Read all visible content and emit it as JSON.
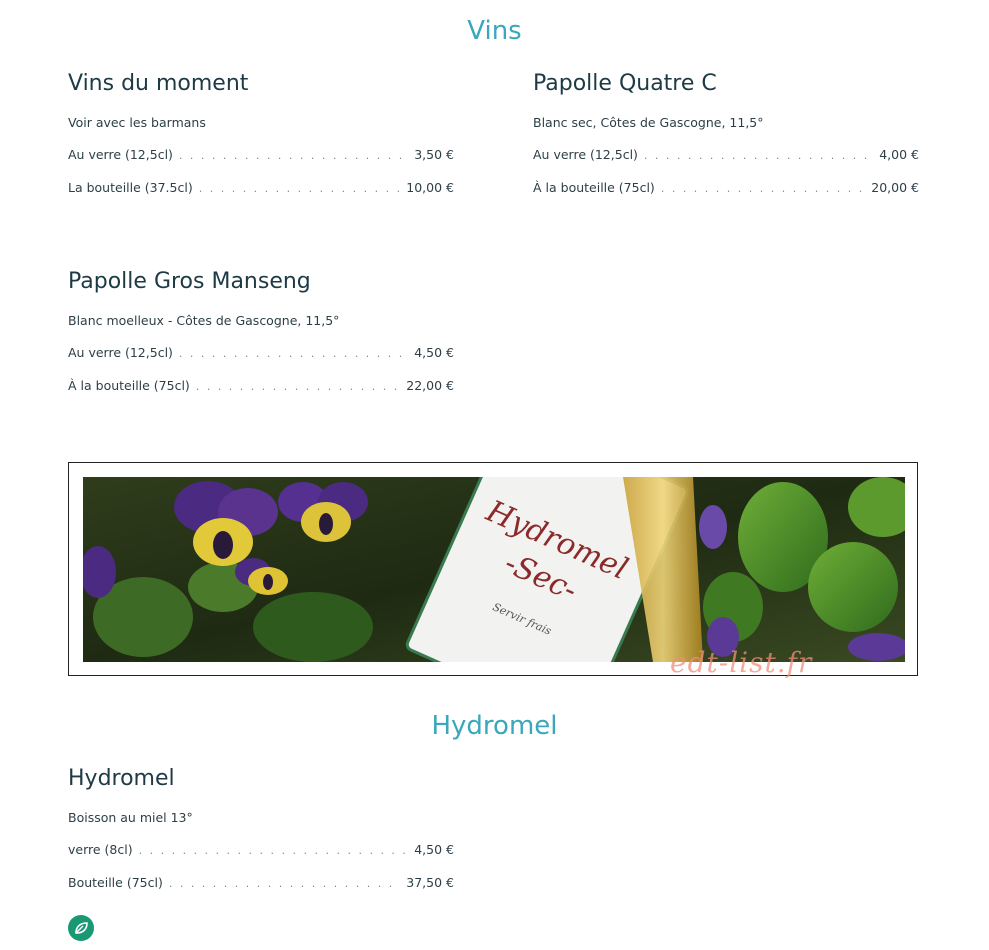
{
  "sections": {
    "wines_title": "Vins",
    "mead_title": "Hydromel"
  },
  "items": [
    {
      "name": "Vins du moment",
      "description": "Voir avec les barmans",
      "prices": [
        {
          "label": "Au verre (12,5cl)",
          "value": "3,50 €"
        },
        {
          "label": "La bouteille (37.5cl)",
          "value": "10,00 €"
        }
      ]
    },
    {
      "name": "Papolle Quatre C",
      "description": "Blanc sec, Côtes de Gascogne, 11,5°",
      "prices": [
        {
          "label": "Au verre (12,5cl)",
          "value": "4,00 €"
        },
        {
          "label": "À la bouteille (75cl)",
          "value": "20,00 €"
        }
      ]
    },
    {
      "name": "Papolle Gros Manseng",
      "description": "Blanc moelleux - Côtes de Gascogne, 11,5°",
      "prices": [
        {
          "label": "Au verre (12,5cl)",
          "value": "4,50 €"
        },
        {
          "label": "À la bouteille (75cl)",
          "value": "22,00 €"
        }
      ]
    },
    {
      "name": "Hydromel",
      "description": "Boisson au miel 13°",
      "prices": [
        {
          "label": "verre (8cl)",
          "value": "4,50 €"
        },
        {
          "label": "Bouteille (75cl)",
          "value": "37,50 €"
        }
      ]
    }
  ],
  "banner": {
    "label_line1": "Hydromel",
    "label_line2": "-Sec-",
    "label_small": "Servir frais"
  },
  "watermark": "edt-list.fr",
  "badge_icon": "leaf-icon",
  "colors": {
    "section_title": "#3aa7bb",
    "item_title": "#1d3a45",
    "badge": "#1a9873"
  }
}
